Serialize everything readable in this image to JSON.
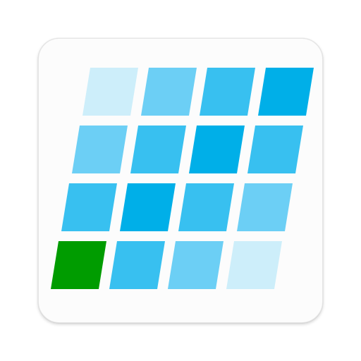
{
  "icon": {
    "name": "tile-grid-app-icon",
    "rows": 4,
    "cols": 4,
    "tiles": [
      [
        "#cdeefa",
        "#6ccff5",
        "#38c0f0",
        "#00afe8"
      ],
      [
        "#6ccff5",
        "#38c0f0",
        "#00afe8",
        "#38c0f0"
      ],
      [
        "#38c0f0",
        "#00afe8",
        "#38c0f0",
        "#6ccff5"
      ],
      [
        "#009c00",
        "#38c0f0",
        "#6ccff5",
        "#cdeefa"
      ]
    ]
  }
}
